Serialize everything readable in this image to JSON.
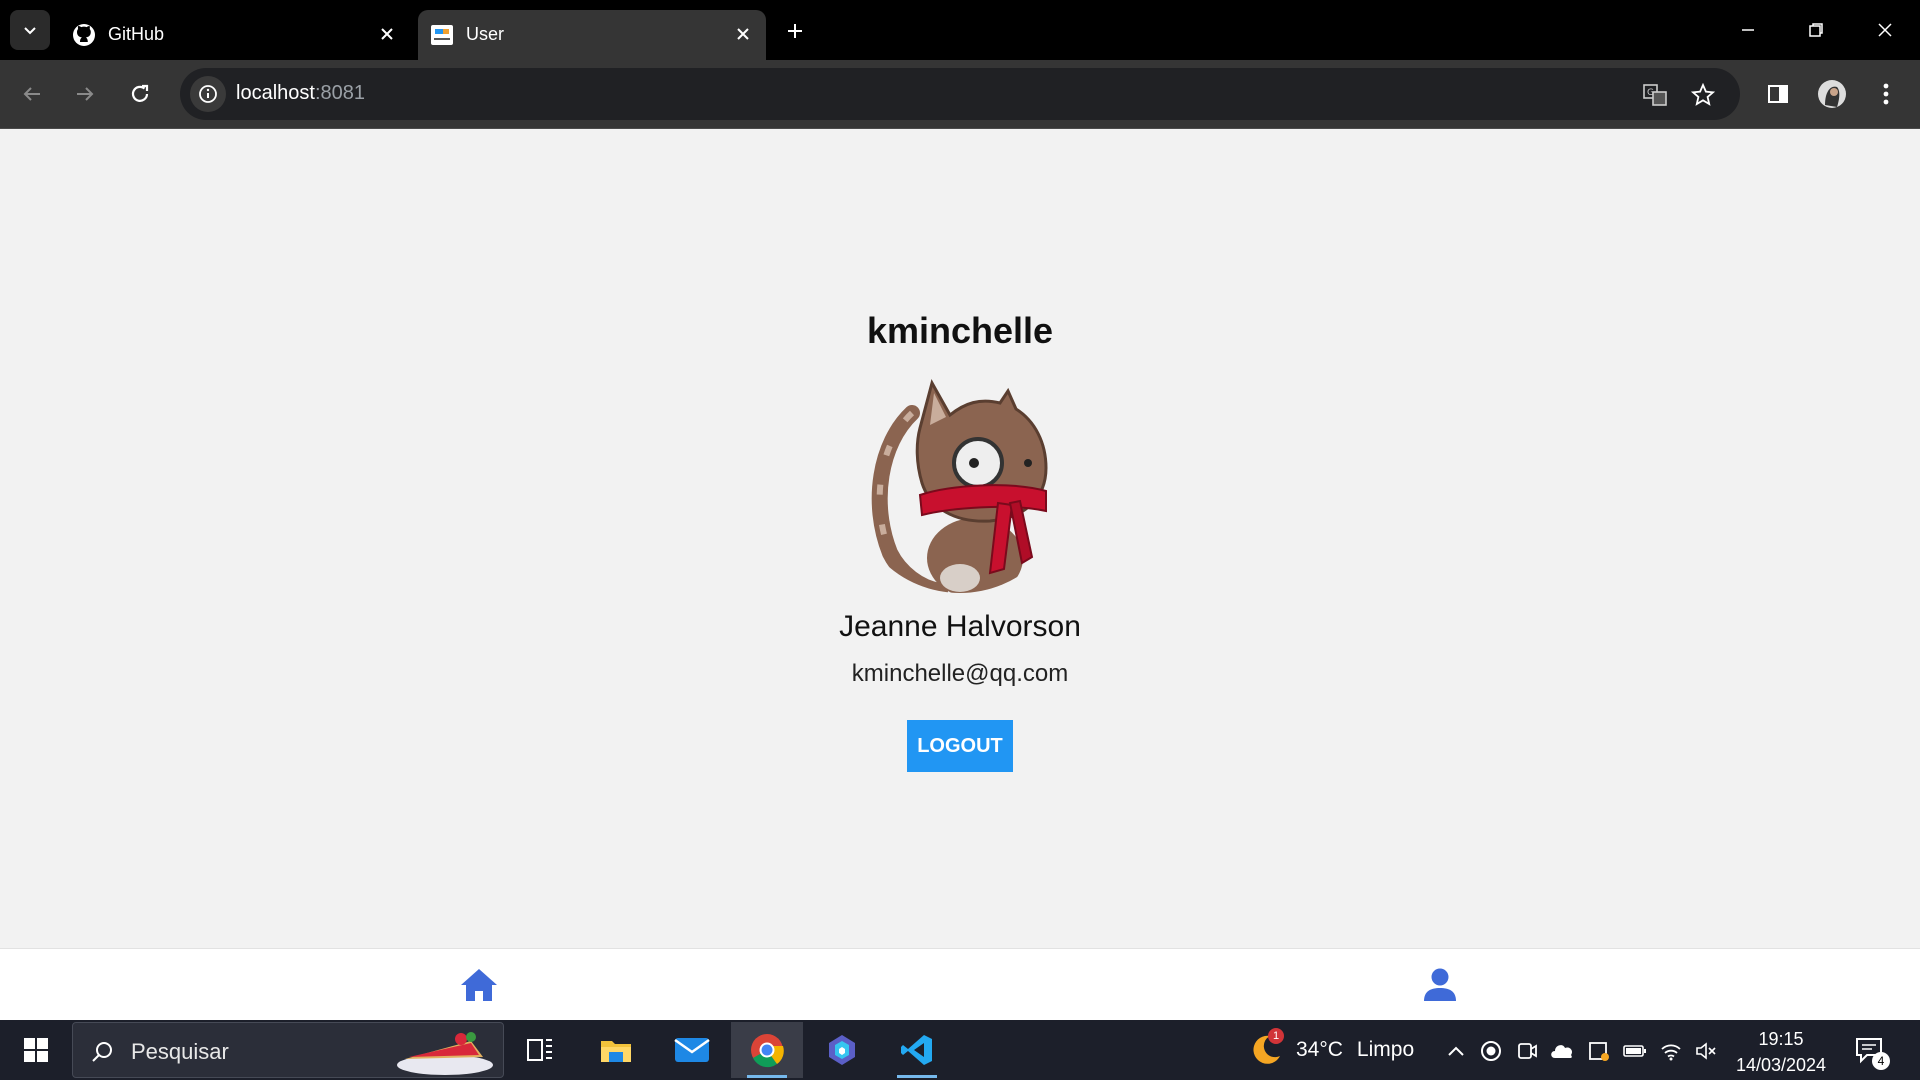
{
  "browser": {
    "tabs": [
      {
        "title": "GitHub",
        "icon": "github-icon",
        "active": false
      },
      {
        "title": "User",
        "icon": "shopper-favicon",
        "active": true
      }
    ],
    "url_host": "localhost",
    "url_port": ":8081"
  },
  "profile": {
    "username": "kminchelle",
    "full_name": "Jeanne Halvorson",
    "email": "kminchelle@qq.com",
    "logout_label": "LOGOUT",
    "avatar": "cat-with-monocle-and-red-scarf"
  },
  "bottom_nav": {
    "items": [
      {
        "icon": "home-icon"
      },
      {
        "icon": "user-icon"
      }
    ]
  },
  "taskbar": {
    "search_placeholder": "Pesquisar",
    "weather_temp": "34°C",
    "weather_desc": "Limpo",
    "weather_badge": "1",
    "time": "19:15",
    "date": "14/03/2024",
    "notification_count": "4"
  },
  "colors": {
    "accent": "#2196f3",
    "nav_icon": "#3f6ad8",
    "page_bg": "#f2f2f2"
  }
}
